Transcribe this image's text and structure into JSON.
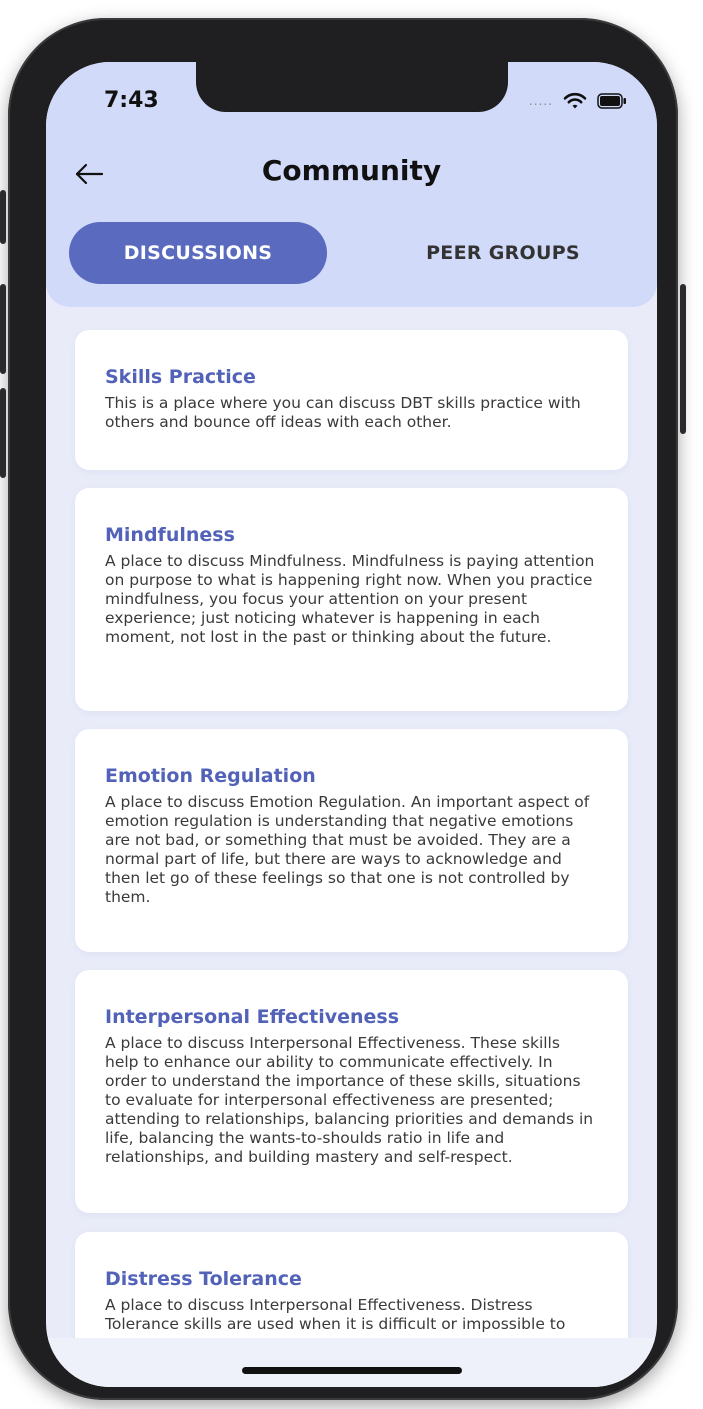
{
  "status_bar": {
    "time": "7:43",
    "signal": "....."
  },
  "header": {
    "title": "Community"
  },
  "tabs": [
    {
      "label": "DISCUSSIONS",
      "active": true
    },
    {
      "label": "PEER GROUPS",
      "active": false
    }
  ],
  "cards": [
    {
      "title": "Skills Practice",
      "description": "This is a place where you can discuss DBT skills practice with others and bounce off ideas with each other."
    },
    {
      "title": "Mindfulness",
      "description": "A place to discuss Mindfulness. Mindfulness is paying attention on purpose to what is happening right now. When you practice mindfulness, you focus your attention on your present experience; just noticing whatever is happening in each moment, not lost in the past or thinking about the future."
    },
    {
      "title": "Emotion Regulation",
      "description": "A place to discuss Emotion Regulation. An important aspect of emotion regulation is understanding that negative emotions are not bad, or something that must be avoided. They are a normal part of life, but there are ways to acknowledge and then let go of these feelings so that one is not controlled by them."
    },
    {
      "title": "Interpersonal Effectiveness",
      "description": "A place to discuss Interpersonal Effectiveness. These skills help to enhance our ability to communicate effectively. In order to understand the importance of these skills, situations to evaluate for interpersonal effectiveness are presented; attending to relationships, balancing priorities and demands in life, balancing the wants-to-shoulds ratio in life and relationships, and building mastery and self-respect."
    },
    {
      "title": "Distress Tolerance",
      "description": "A place to discuss Interpersonal Effectiveness. Distress Tolerance skills are used when it is difficult or impossible to"
    }
  ],
  "colors": {
    "header_bg": "#d1daf9",
    "accent": "#5a6abf",
    "card_title": "#5262b8",
    "screen_bg": "#e9ecf8"
  }
}
